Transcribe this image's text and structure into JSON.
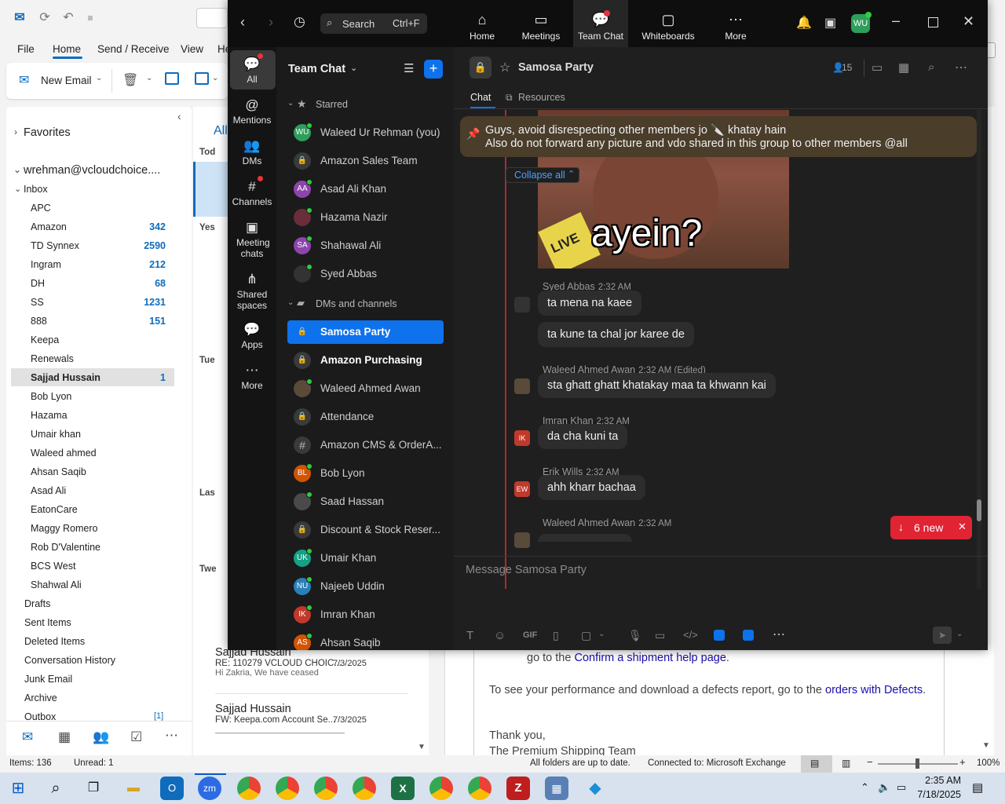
{
  "outlook": {
    "menu": [
      "File",
      "Home",
      "Send / Receive",
      "View",
      "He"
    ],
    "new_email": "New Email",
    "favorites": "Favorites",
    "account": "wrehman@vcloudchoice....",
    "inbox": "Inbox",
    "folders": [
      {
        "name": "APC",
        "count": ""
      },
      {
        "name": "Amazon",
        "count": "342"
      },
      {
        "name": "TD Synnex",
        "count": "2590"
      },
      {
        "name": "Ingram",
        "count": "212"
      },
      {
        "name": "DH",
        "count": "68"
      },
      {
        "name": "SS",
        "count": "1231"
      },
      {
        "name": "888",
        "count": "151"
      },
      {
        "name": "Keepa",
        "count": ""
      },
      {
        "name": "Renewals",
        "count": ""
      },
      {
        "name": "Sajjad Hussain",
        "count": "1"
      },
      {
        "name": "Bob Lyon",
        "count": ""
      },
      {
        "name": "Hazama",
        "count": ""
      },
      {
        "name": "Umair khan",
        "count": ""
      },
      {
        "name": "Waleed ahmed",
        "count": ""
      },
      {
        "name": "Ahsan Saqib",
        "count": ""
      },
      {
        "name": "Asad Ali",
        "count": ""
      },
      {
        "name": "EatonCare",
        "count": ""
      },
      {
        "name": "Maggy Romero",
        "count": ""
      },
      {
        "name": "Rob D'Valentine",
        "count": ""
      },
      {
        "name": "BCS West",
        "count": ""
      },
      {
        "name": "Shahwal Ali",
        "count": ""
      }
    ],
    "top_folders": [
      "Drafts",
      "Sent Items",
      "Deleted Items",
      "Conversation History",
      "Junk Email",
      "Archive",
      "Outbox"
    ],
    "outbox_count": "[1]",
    "list_tab": "All",
    "groups": [
      "Tod",
      "Yes",
      "Tue",
      "Las",
      "Twe"
    ],
    "mails": [
      {
        "sender": "Sajjad Hussain",
        "subject": "RE: 110279 VCLOUD CHOIC...",
        "date": "7/3/2025",
        "preview": "Hi Zakria,  We have ceased"
      },
      {
        "sender": "Sajjad Hussain",
        "subject": "FW: Keepa.com Account Se...",
        "date": "7/3/2025",
        "preview": "________________________________"
      }
    ],
    "reading": {
      "line1_pre": "go to the ",
      "line1_link": "Confirm a shipment help page",
      "line1_post": ".",
      "line2_pre": "To see your performance and download a defects report, go to the ",
      "line2_link": "orders with Defects",
      "line2_post": ".",
      "thanks": "Thank you,",
      "team": "The Premium Shipping Team"
    },
    "status": {
      "items": "Items: 136",
      "unread": "Unread: 1",
      "folders": "All folders are up to date.",
      "connected": "Connected to: Microsoft Exchange",
      "zoom": "100%"
    }
  },
  "zoom": {
    "search": "Search",
    "search_shortcut": "Ctrl+F",
    "tabs": [
      "Home",
      "Meetings",
      "Team Chat",
      "Whiteboards",
      "More"
    ],
    "user_initials": "WU",
    "rail": [
      "All",
      "Mentions",
      "DMs",
      "Channels",
      "Meeting chats",
      "Shared spaces",
      "Apps",
      "More"
    ],
    "sidebar_title": "Team Chat",
    "starred_label": "Starred",
    "starred": [
      {
        "name": "Waleed Ur Rehman (you)",
        "initials": "WU",
        "color": "#2e9e5b",
        "type": "user"
      },
      {
        "name": "Amazon Sales Team",
        "initials": "",
        "color": "#3a3a3a",
        "type": "lock"
      },
      {
        "name": "Asad Ali Khan",
        "initials": "AA",
        "color": "#8e44ad",
        "type": "user"
      },
      {
        "name": "Hazama Nazir",
        "initials": "",
        "color": "#6b2d3a",
        "type": "photo"
      },
      {
        "name": "Shahawal Ali",
        "initials": "SA",
        "color": "#8e44ad",
        "type": "user"
      },
      {
        "name": "Syed Abbas",
        "initials": "",
        "color": "#333333",
        "type": "photo"
      }
    ],
    "dms_label": "DMs and channels",
    "dms": [
      {
        "name": "Samosa Party",
        "initials": "",
        "color": "#3a3a3a",
        "type": "lock",
        "selected": true
      },
      {
        "name": "Amazon Purchasing",
        "initials": "",
        "color": "#3a3a3a",
        "type": "lock",
        "bold": true
      },
      {
        "name": "Waleed Ahmed Awan",
        "initials": "",
        "color": "#5a4a3a",
        "type": "photo"
      },
      {
        "name": "Attendance",
        "initials": "",
        "color": "#3a3a3a",
        "type": "lock"
      },
      {
        "name": "Amazon CMS & OrderA...",
        "initials": "#",
        "color": "#3a3a3a",
        "type": "hash"
      },
      {
        "name": "Bob Lyon",
        "initials": "BL",
        "color": "#d35400",
        "type": "user"
      },
      {
        "name": "Saad Hassan",
        "initials": "",
        "color": "#4a4a4a",
        "type": "photo"
      },
      {
        "name": "Discount & Stock Reser...",
        "initials": "",
        "color": "#3a3a3a",
        "type": "lock"
      },
      {
        "name": "Umair Khan",
        "initials": "UK",
        "color": "#16a085",
        "type": "user"
      },
      {
        "name": "Najeeb Uddin",
        "initials": "NU",
        "color": "#2980b9",
        "type": "user"
      },
      {
        "name": "Imran Khan",
        "initials": "IK",
        "color": "#c0392b",
        "type": "user"
      },
      {
        "name": "Ahsan Saqib",
        "initials": "AS",
        "color": "#d35400",
        "type": "user"
      }
    ],
    "channel": {
      "name": "Samosa Party",
      "members": "15",
      "tabs": [
        "Chat",
        "Resources"
      ],
      "pinned_line1": "Guys, avoid disrespecting other members jo 🔪 khatay hain",
      "pinned_line2": "Also do not forward any picture and vdo shared in this group to other members @all",
      "collapse": "Collapse all",
      "image_caption": "ayein?",
      "image_sticker": "LIVE",
      "new_badge": "6 new",
      "composer_placeholder": "Message Samosa Party",
      "gif": "GIF"
    },
    "messages": [
      {
        "name": "Syed Abbas",
        "time": "2:32 AM",
        "initials": "",
        "lines": [
          "ta mena  na kaee",
          "ta kune ta chal jor karee de"
        ]
      },
      {
        "name": "Waleed Ahmed Awan",
        "time": "2:32 AM (Edited)",
        "initials": "",
        "lines": [
          "sta ghatt ghatt khatakay maa ta khwann kai"
        ]
      },
      {
        "name": "Imran Khan",
        "time": "2:32 AM",
        "initials": "IK",
        "lines": [
          "da cha kuni ta"
        ]
      },
      {
        "name": "Erik Wills",
        "time": "2:32 AM",
        "initials": "EW",
        "lines": [
          "ahh kharr bachaa"
        ]
      },
      {
        "name": "Waleed Ahmed Awan",
        "time": "2:32 AM",
        "initials": "",
        "lines": []
      }
    ]
  },
  "taskbar": {
    "time": "2:35 AM",
    "date": "7/18/2025"
  }
}
